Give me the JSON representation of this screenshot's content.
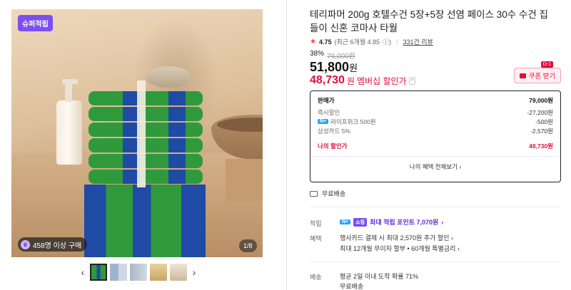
{
  "gallery": {
    "badge": "슈퍼적립",
    "buyers": "458명 이상 구매",
    "counter": "1/8"
  },
  "product": {
    "title": "테리파머 200g 호텔수건 5장+5장 선염 페이스 30수 수건 집들이 신혼 코마사 타월",
    "rating": "4.75",
    "rating_detail": "(최근 6개월 4.85",
    "reviews": "331건 리뷰",
    "discount_rate": "38%",
    "original_price": "79,000원",
    "price": "51,800",
    "price_unit": "원",
    "member_price": "48,730",
    "member_unit": "원",
    "member_label": "멤버십 할인가",
    "coupon_label": "쿠폰 받기",
    "coupon_tag": "D-1"
  },
  "price_box": {
    "head_label": "판매가",
    "head_value": "79,000원",
    "rows": [
      {
        "label": "즉시할인",
        "value": "-27,200원"
      },
      {
        "label": "라이프위크 500원",
        "value": "-500원",
        "badge": "N+"
      },
      {
        "label": "삼성카드 5%",
        "value": "-2,570원"
      }
    ],
    "my_label": "나의 할인가",
    "my_value": "48,730원",
    "all_benefits": "나의 혜택 전체보기"
  },
  "shipping_top": "무료배송",
  "benefits": {
    "point_label": "적립",
    "point_badge": "N+",
    "point_badge2": "쇼핑",
    "point_text": "최대 적립 포인트 7,070원",
    "perk_label": "혜택",
    "perk_line1": "행사카드 결제 시 최대 2,570원 추가 할인",
    "perk_line2": "최대 12개월 무이자 할부 • 60개월 특별금리"
  },
  "delivery": {
    "label": "배송",
    "line1": "평균 2일 이내 도착 확률 71%",
    "line2": "무료배송"
  },
  "colors": {
    "accent_red": "#e0103a",
    "purple": "#7b4ff0",
    "npay_blue": "#1ea5ff"
  }
}
